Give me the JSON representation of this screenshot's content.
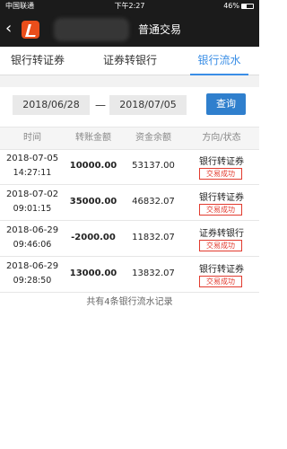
{
  "status_bar": {
    "carrier": "中国联通",
    "time": "下午2:27",
    "battery": "46%"
  },
  "nav": {
    "title": "普通交易"
  },
  "tabs": [
    {
      "label": "银行转证券",
      "active": false
    },
    {
      "label": "证券转银行",
      "active": false
    },
    {
      "label": "银行流水",
      "active": true
    }
  ],
  "query": {
    "start_date": "2018/06/28",
    "separator": "—",
    "end_date": "2018/07/05",
    "button_label": "查询"
  },
  "table": {
    "headers": [
      "时间",
      "转账金额",
      "资金余额",
      "方向/状态"
    ],
    "rows": [
      {
        "date": "2018-07-05",
        "time": "14:27:11",
        "amount": "10000.00",
        "balance": "53137.00",
        "direction": "银行转证券",
        "status": "交易成功"
      },
      {
        "date": "2018-07-02",
        "time": "09:01:15",
        "amount": "35000.00",
        "balance": "46832.07",
        "direction": "银行转证券",
        "status": "交易成功"
      },
      {
        "date": "2018-06-29",
        "time": "09:46:06",
        "amount": "-2000.00",
        "balance": "11832.07",
        "direction": "证券转银行",
        "status": "交易成功"
      },
      {
        "date": "2018-06-29",
        "time": "09:28:50",
        "amount": "13000.00",
        "balance": "13832.07",
        "direction": "银行转证券",
        "status": "交易成功"
      }
    ]
  },
  "footer": {
    "summary": "共有4条银行流水记录"
  },
  "colors": {
    "accent": "#3a8ee6",
    "button": "#2f7fcd",
    "status": "#e23b2f",
    "logo": "#e94e1b",
    "header_bg": "#1b1b1b"
  }
}
